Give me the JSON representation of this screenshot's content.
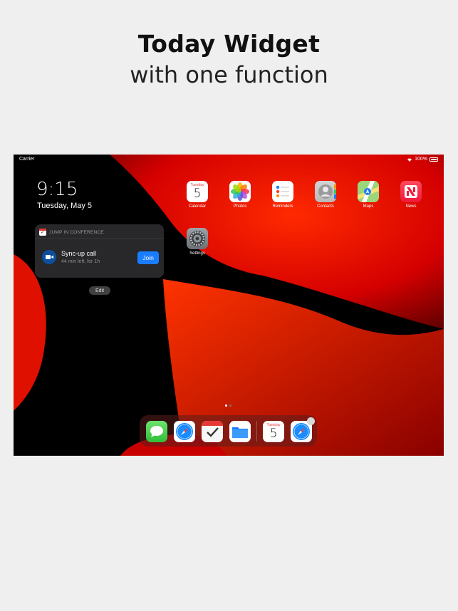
{
  "header": {
    "title": "Today Widget",
    "subtitle": "with one function"
  },
  "status_bar": {
    "carrier": "Carrier",
    "battery": "100%"
  },
  "lock": {
    "time": "9:15",
    "date": "Tuesday, May 5"
  },
  "widget": {
    "title": "JUMP IN CONFERENCE",
    "meeting_title": "Sync-up call",
    "meeting_time": "44 min left,  for 1h",
    "join_label": "Join",
    "edit_label": "Edit"
  },
  "apps": [
    {
      "label": "Calendar",
      "icon": "calendar-icon",
      "day": "Tuesday",
      "date": "5"
    },
    {
      "label": "Photos",
      "icon": "photos-icon"
    },
    {
      "label": "Reminders",
      "icon": "reminders-icon"
    },
    {
      "label": "Contacts",
      "icon": "contacts-icon"
    },
    {
      "label": "Maps",
      "icon": "maps-icon"
    },
    {
      "label": "News",
      "icon": "news-icon"
    },
    {
      "label": "Settings",
      "icon": "settings-icon"
    }
  ],
  "dock": {
    "apps": [
      "messages-icon",
      "safari-icon",
      "reminders-app-icon",
      "files-icon",
      "calendar-icon",
      "safari-icon"
    ],
    "calendar_day": "Tuesday",
    "calendar_date": "5"
  },
  "colors": {
    "accent": "#1a7cff",
    "wallpaper_red": "#ff1a00",
    "page_background": "#efefef"
  }
}
